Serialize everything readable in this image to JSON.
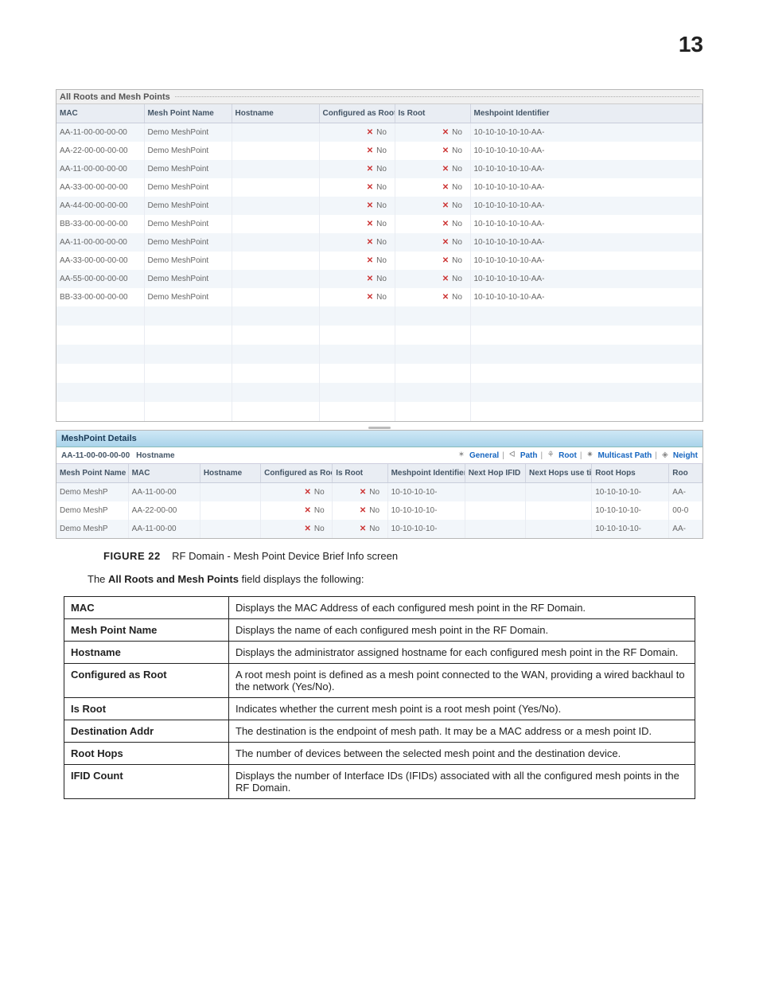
{
  "page_number": "13",
  "panel1": {
    "title": "All Roots and Mesh Points",
    "columns": [
      "MAC",
      "Mesh Point Name",
      "Hostname",
      "Configured as Root",
      "Is Root",
      "Meshpoint Identifier"
    ],
    "rows": [
      {
        "mac": "AA-11-00-00-00-00",
        "name": "Demo MeshPoint",
        "host": "",
        "cfg": "No",
        "root": "No",
        "id": "10-10-10-10-10-AA-"
      },
      {
        "mac": "AA-22-00-00-00-00",
        "name": "Demo MeshPoint",
        "host": "",
        "cfg": "No",
        "root": "No",
        "id": "10-10-10-10-10-AA-"
      },
      {
        "mac": "AA-11-00-00-00-00",
        "name": "Demo MeshPoint",
        "host": "",
        "cfg": "No",
        "root": "No",
        "id": "10-10-10-10-10-AA-"
      },
      {
        "mac": "AA-33-00-00-00-00",
        "name": "Demo MeshPoint",
        "host": "",
        "cfg": "No",
        "root": "No",
        "id": "10-10-10-10-10-AA-"
      },
      {
        "mac": "AA-44-00-00-00-00",
        "name": "Demo MeshPoint",
        "host": "",
        "cfg": "No",
        "root": "No",
        "id": "10-10-10-10-10-AA-"
      },
      {
        "mac": "BB-33-00-00-00-00",
        "name": "Demo MeshPoint",
        "host": "",
        "cfg": "No",
        "root": "No",
        "id": "10-10-10-10-10-AA-"
      },
      {
        "mac": "AA-11-00-00-00-00",
        "name": "Demo MeshPoint",
        "host": "",
        "cfg": "No",
        "root": "No",
        "id": "10-10-10-10-10-AA-"
      },
      {
        "mac": "AA-33-00-00-00-00",
        "name": "Demo MeshPoint",
        "host": "",
        "cfg": "No",
        "root": "No",
        "id": "10-10-10-10-10-AA-"
      },
      {
        "mac": "AA-55-00-00-00-00",
        "name": "Demo MeshPoint",
        "host": "",
        "cfg": "No",
        "root": "No",
        "id": "10-10-10-10-10-AA-"
      },
      {
        "mac": "BB-33-00-00-00-00",
        "name": "Demo MeshPoint",
        "host": "",
        "cfg": "No",
        "root": "No",
        "id": "10-10-10-10-10-AA-"
      }
    ],
    "empty_rows": 6
  },
  "panel2": {
    "title": "MeshPoint Details",
    "info_mac": "AA-11-00-00-00-00",
    "info_host_label": "Hostname",
    "tabs": {
      "general": "General",
      "path": "Path",
      "root": "Root",
      "multicast": "Multicast Path",
      "neigh": "Neight"
    },
    "columns": [
      "Mesh Point Name",
      "MAC",
      "Hostname",
      "Configured as Root",
      "Is Root",
      "Meshpoint Identifier",
      "Next Hop IFID",
      "Next Hops use time",
      "Root Hops",
      "Roo"
    ],
    "rows": [
      {
        "name": "Demo MeshP",
        "mac": "AA-11-00-00",
        "host": "",
        "cfg": "No",
        "root": "No",
        "id": "10-10-10-10-",
        "nh": "",
        "nht": "",
        "rh": "10-10-10-10-",
        "roo": "AA-"
      },
      {
        "name": "Demo MeshP",
        "mac": "AA-22-00-00",
        "host": "",
        "cfg": "No",
        "root": "No",
        "id": "10-10-10-10-",
        "nh": "",
        "nht": "",
        "rh": "10-10-10-10-",
        "roo": "00-0"
      },
      {
        "name": "Demo MeshP",
        "mac": "AA-11-00-00",
        "host": "",
        "cfg": "No",
        "root": "No",
        "id": "10-10-10-10-",
        "nh": "",
        "nht": "",
        "rh": "10-10-10-10-",
        "roo": "AA-"
      }
    ]
  },
  "caption": {
    "label": "FIGURE 22",
    "text": "RF Domain - Mesh Point Device Brief Info screen"
  },
  "para": {
    "pre": "The ",
    "bold": "All Roots and Mesh Points",
    "post": " field displays the following:"
  },
  "defs": [
    {
      "k": "MAC",
      "v": "Displays the MAC Address of each configured mesh point in the RF Domain."
    },
    {
      "k": "Mesh Point Name",
      "v": "Displays the name of each configured mesh point in the RF Domain."
    },
    {
      "k": "Hostname",
      "v": "Displays the administrator assigned hostname for each configured mesh point in the RF Domain."
    },
    {
      "k": "Configured as Root",
      "v": "A root mesh point is defined as a mesh point connected to the WAN, providing a wired backhaul to the network (Yes/No)."
    },
    {
      "k": "Is Root",
      "v": "Indicates whether the current mesh point is a root mesh point (Yes/No)."
    },
    {
      "k": "Destination Addr",
      "v": "The destination is the endpoint of mesh path. It may be a MAC address or a mesh point ID."
    },
    {
      "k": "Root Hops",
      "v": "The number of devices between the selected mesh point and the destination device."
    },
    {
      "k": "IFID Count",
      "v": "Displays the number of Interface IDs (IFIDs) associated with all the configured mesh points in the RF Domain."
    }
  ]
}
